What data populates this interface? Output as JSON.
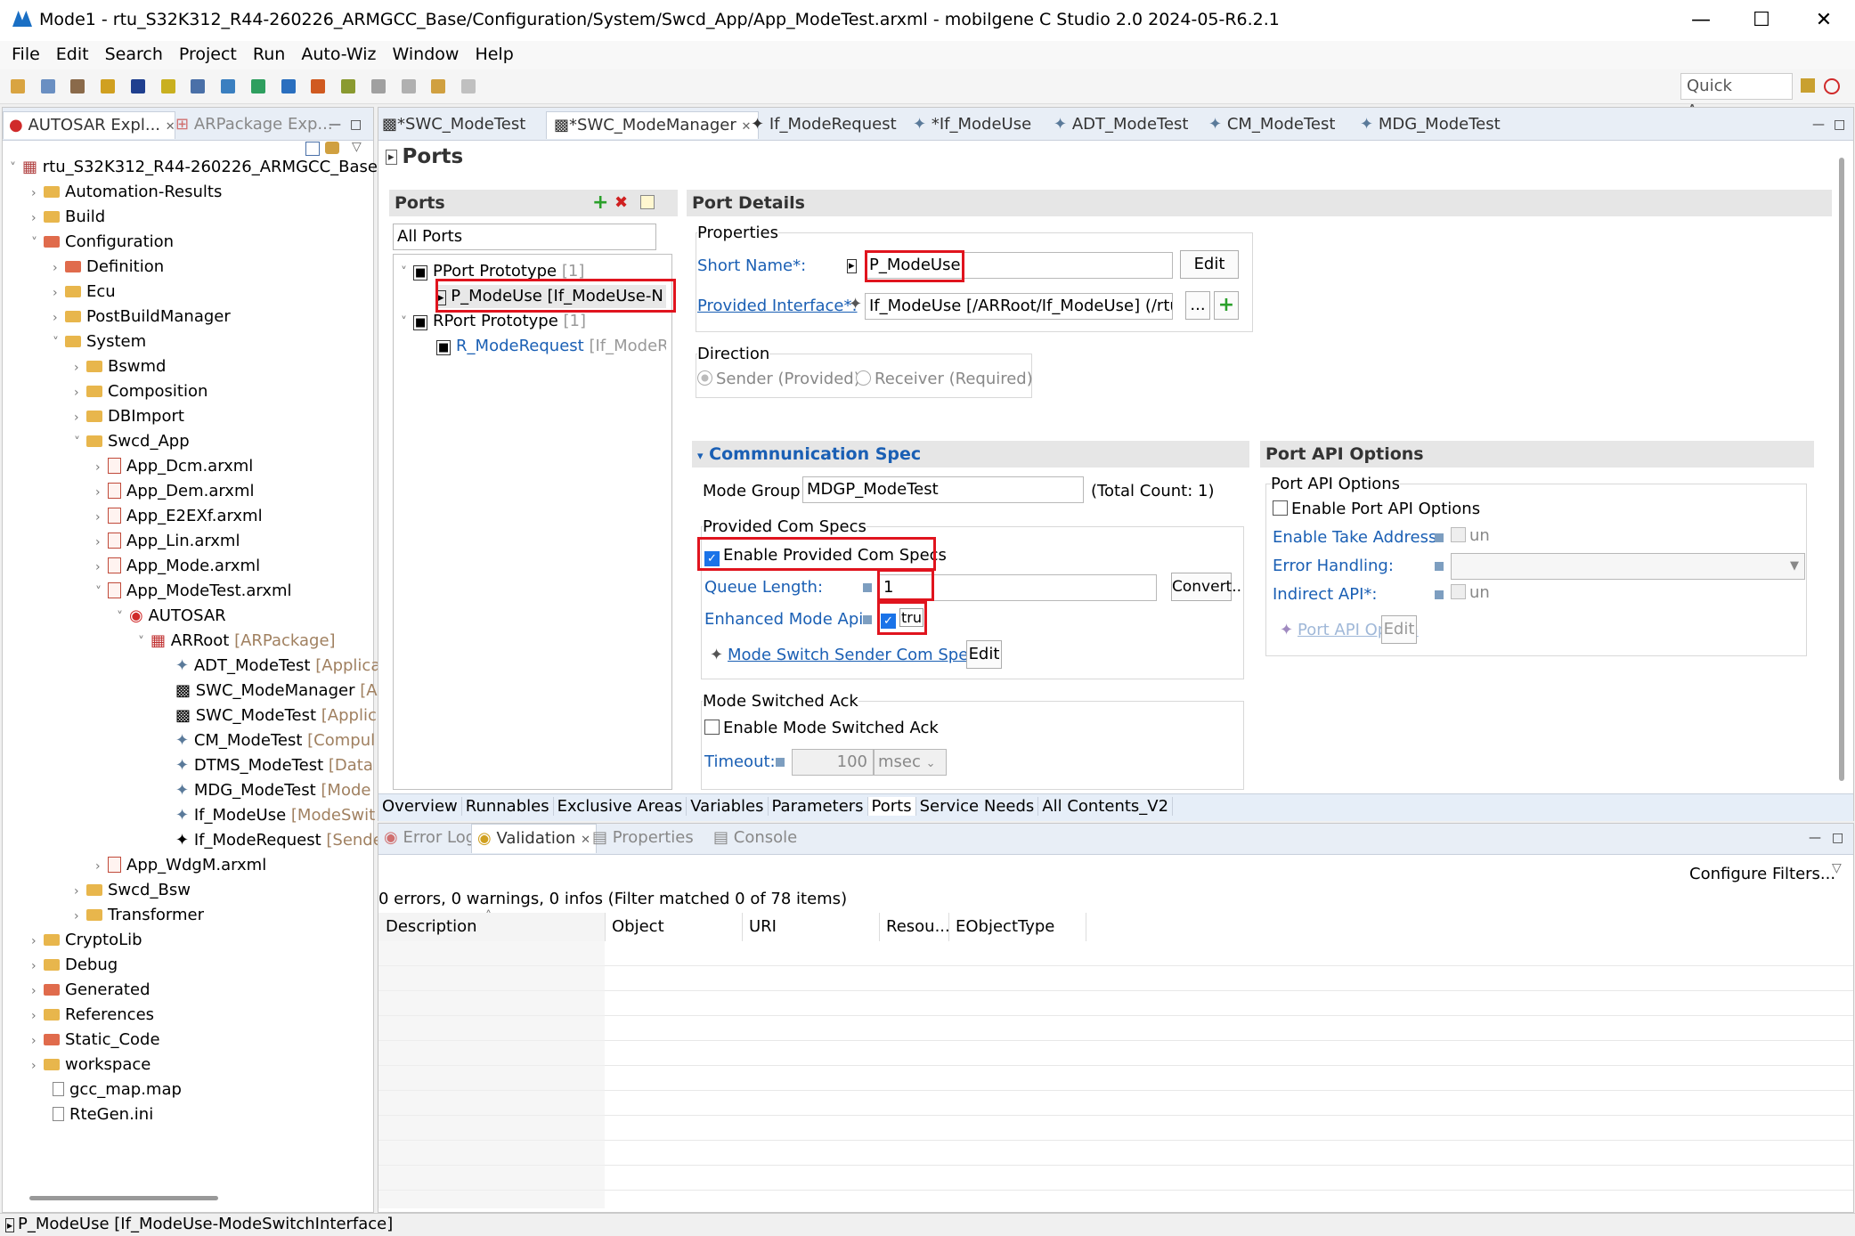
{
  "window": {
    "title": "Mode1 - rtu_S32K312_R44-260226_ARMGCC_Base/Configuration/System/Swcd_App/App_ModeTest.arxml - mobilgene C Studio 2.0 2024-05-R6.2.1"
  },
  "menu": [
    "File",
    "Edit",
    "Search",
    "Project",
    "Run",
    "Auto-Wiz",
    "Window",
    "Help"
  ],
  "quick_access": "Quick Access",
  "left_tabs": {
    "explorer": "AUTOSAR Expl...",
    "package": "ARPackage Exp..."
  },
  "tree": {
    "root": "rtu_S32K312_R44-260226_ARMGCC_Base",
    "automation": "Automation-Results",
    "build": "Build",
    "configuration": "Configuration",
    "definition": "Definition",
    "ecu": "Ecu",
    "postbuild": "PostBuildManager",
    "system": "System",
    "bswmd": "Bswmd",
    "composition": "Composition",
    "dbimport": "DBImport",
    "swcd_app": "Swcd_App",
    "f_dcm": "App_Dcm.arxml",
    "f_dem": "App_Dem.arxml",
    "f_e2exf": "App_E2EXf.arxml",
    "f_lin": "App_Lin.arxml",
    "f_mode": "App_Mode.arxml",
    "f_modetest": "App_ModeTest.arxml",
    "autosar": "AUTOSAR",
    "arroot": "ARRoot",
    "arroot_type": "[ARPackage]",
    "adt": "ADT_ModeTest",
    "adt_type": "[Applica",
    "swc_mgr": "SWC_ModeManager",
    "swc_mgr_type": "[Ap",
    "swc_test": "SWC_ModeTest",
    "swc_test_type": "[Applic",
    "cm": "CM_ModeTest",
    "cm_type": "[Compul",
    "dtms": "DTMS_ModeTest",
    "dtms_type": "[Data",
    "mdg": "MDG_ModeTest",
    "mdg_type": "[Mode",
    "ifuse": "If_ModeUse",
    "ifuse_type": "[ModeSwit",
    "ifreq": "If_ModeRequest",
    "ifreq_type": "[Sende",
    "f_wdgm": "App_WdgM.arxml",
    "swcd_bsw": "Swcd_Bsw",
    "transformer": "Transformer",
    "cryptolib": "CryptoLib",
    "debug": "Debug",
    "generated": "Generated",
    "references": "References",
    "static_code": "Static_Code",
    "workspace": "workspace",
    "gccmap": "gcc_map.map",
    "rtegen": "RteGen.ini"
  },
  "editor_tabs": [
    "*SWC_ModeTest",
    "*SWC_ModeManager",
    "If_ModeRequest",
    "*If_ModeUse",
    "ADT_ModeTest",
    "CM_ModeTest",
    "MDG_ModeTest"
  ],
  "page_title": "Ports",
  "ports": {
    "header": "Ports",
    "filter": "All Ports",
    "pport_label": "PPort Prototype",
    "pport_count": "[1]",
    "p_item": "P_ModeUse [If_ModeUse-N",
    "rport_label": "RPort Prototype",
    "rport_count": "[1]",
    "r_item": "R_ModeRequest",
    "r_item_type": "[If_ModeR"
  },
  "details": {
    "header": "Port Details",
    "properties": "Properties",
    "short_name_label": "Short Name*:",
    "short_name": "P_ModeUse",
    "edit": "Edit",
    "provided_if_label": "Provided Interface*:",
    "provided_if": "If_ModeUse [/ARRoot/If_ModeUse] (/rtu_S",
    "ellipsis": "...",
    "direction": "Direction",
    "sender": "Sender (Provided)",
    "receiver": "Receiver (Required)"
  },
  "comm": {
    "header": "Commnunication Spec",
    "mode_group_label": "Mode Group",
    "mode_group": "MDGP_ModeTest",
    "total_count": "(Total Count: 1)",
    "provided_specs": "Provided Com Specs",
    "enable_provided": "Enable Provided Com Specs",
    "queue_label": "Queue Length:",
    "queue_value": "1",
    "convert": "Convert..",
    "enhanced_label": "Enhanced Mode Api:",
    "enhanced_value": "tru",
    "mode_switch_link": "Mode Switch Sender Com Spec",
    "edit": "Edit",
    "ack_group": "Mode Switched Ack",
    "enable_ack": "Enable Mode Switched Ack",
    "timeout_label": "Timeout:",
    "timeout_value": "100",
    "timeout_unit": "msec"
  },
  "api": {
    "header": "Port API Options",
    "group": "Port API Options",
    "enable": "Enable Port API Options",
    "take_address": "Enable Take Address:",
    "un1": "un",
    "error_handling": "Error Handling:",
    "indirect": "Indirect API*:",
    "un2": "un",
    "option_link": "Port API Option",
    "edit": "Edit"
  },
  "bottom_editor_tabs": [
    "Overview",
    "Runnables",
    "Exclusive Areas",
    "Variables",
    "Parameters",
    "Ports",
    "Service Needs",
    "All Contents_V2"
  ],
  "views": {
    "error_log": "Error Log",
    "validation": "Validation",
    "properties": "Properties",
    "console": "Console"
  },
  "validation": {
    "summary": "0 errors, 0 warnings, 0 infos (Filter matched 0 of 78 items)",
    "configure": "Configure Filters...",
    "columns": [
      "Description",
      "Object",
      "URI",
      "Resou...",
      "EObjectType"
    ]
  },
  "status": "P_ModeUse [If_ModeUse-ModeSwitchInterface]"
}
